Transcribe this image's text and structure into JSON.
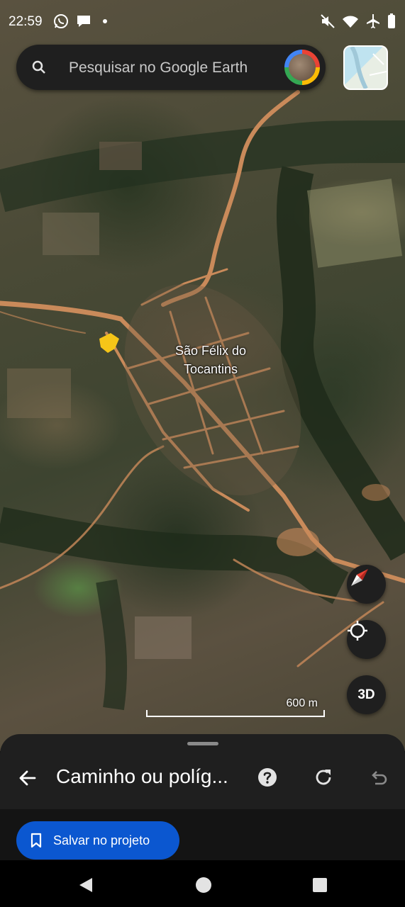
{
  "status_bar": {
    "time": "22:59",
    "left_icons": [
      "whatsapp-icon",
      "chat-bubble-icon",
      "dot-icon"
    ],
    "right_icons": [
      "mute-icon",
      "wifi-icon",
      "airplane-icon",
      "battery-icon"
    ]
  },
  "search": {
    "placeholder": "Pesquisar no Google Earth"
  },
  "map": {
    "place_label_line1": "São Félix do",
    "place_label_line2": "Tocantins",
    "scale_label": "600 m",
    "threed_label": "3D"
  },
  "sheet": {
    "title": "Caminho ou políg...",
    "save_button": "Salvar no projeto"
  },
  "colors": {
    "accent": "#0b57d0",
    "sheet_bg": "#1f1f1f",
    "road": "#c98a5a",
    "marker": "#f5c518"
  }
}
